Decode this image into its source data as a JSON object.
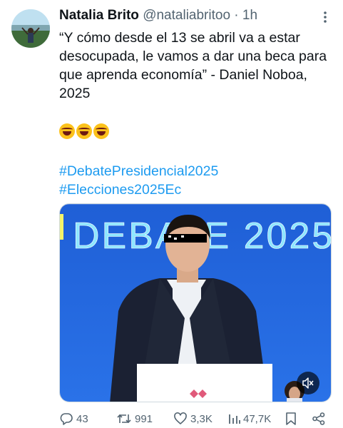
{
  "author": {
    "name": "Natalia Brito",
    "handle": "@nataliabritoo",
    "separator": "·",
    "time": "1h"
  },
  "tweet": {
    "text": "“Y cómo desde el 13 se abril va a estar desocupada, le vamos a dar una beca para que aprenda economía” - Daniel Noboa, 2025",
    "emojis": [
      "face-with-tears-of-joy",
      "face-with-tears-of-joy",
      "face-with-tears-of-joy"
    ],
    "hashtags": [
      "#DebatePresidencial2025",
      "#Elecciones2025Ec"
    ]
  },
  "media": {
    "banner_text": "DEBATE 2025",
    "muted": true
  },
  "actions": {
    "replies": "43",
    "retweets": "991",
    "likes": "3,3K",
    "views": "47,7K"
  },
  "colors": {
    "link": "#1d9bf0",
    "secondary_text": "#536471",
    "screen_blue": "#1f60d8",
    "banner_text": "#8ee6ff"
  }
}
